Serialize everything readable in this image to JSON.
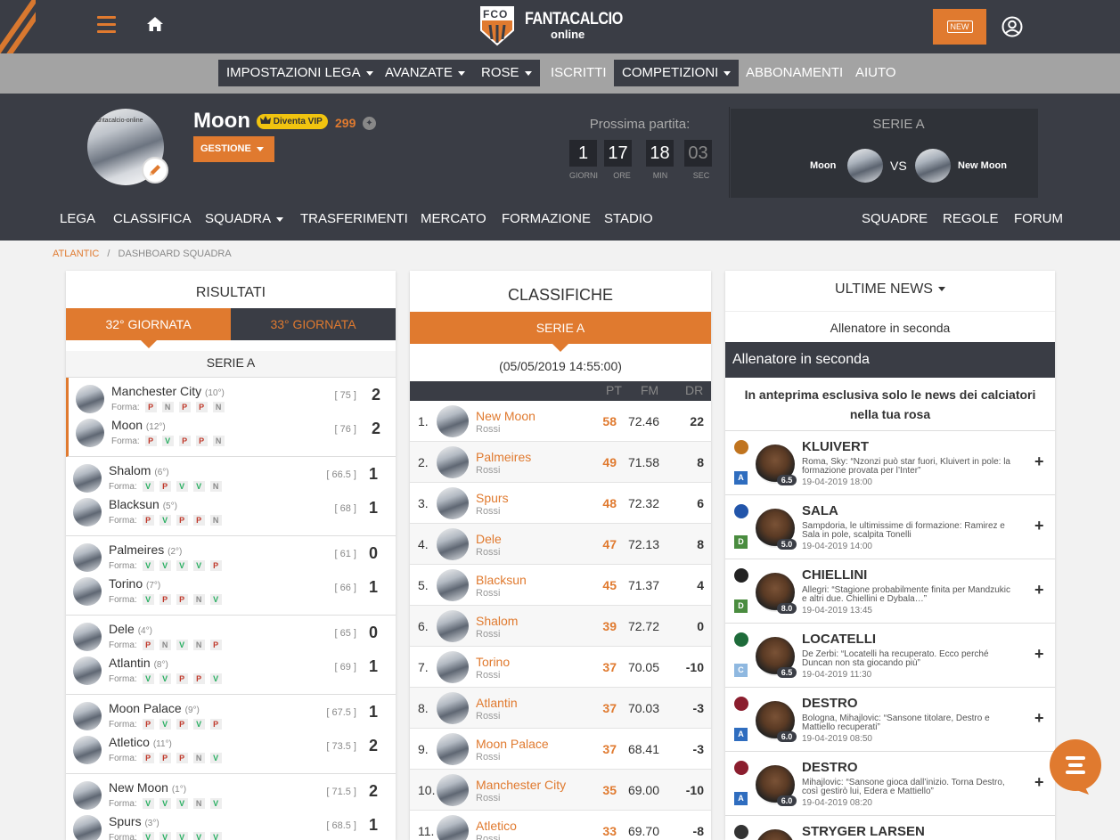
{
  "brand": {
    "logo_mark": "FCO",
    "logo_title": "FANTACALCIO",
    "logo_sub": "online",
    "new_label": "NEW"
  },
  "menu": [
    {
      "label": "IMPOSTAZIONI LEGA",
      "dropdown": true
    },
    {
      "label": "AVANZATE",
      "dropdown": true
    },
    {
      "label": "ROSE",
      "dropdown": true
    },
    {
      "label": "ISCRITTI",
      "dropdown": false
    },
    {
      "label": "COMPETIZIONI",
      "dropdown": true
    },
    {
      "label": "ABBONAMENTI",
      "dropdown": false
    },
    {
      "label": "AIUTO",
      "dropdown": false
    }
  ],
  "team": {
    "name": "Moon",
    "vip_label": "Diventa VIP",
    "credits": "299",
    "gestione_label": "GESTIONE",
    "avatar_text": "fantacalcio-online"
  },
  "next_match": {
    "label": "Prossima partita:",
    "countdown": [
      {
        "value": "1",
        "unit": "GIORNI"
      },
      {
        "value": "17",
        "unit": "ORE"
      },
      {
        "value": "18",
        "unit": "MIN"
      },
      {
        "value": "03",
        "unit": "SEC"
      }
    ],
    "competition": "SERIE A",
    "home": "Moon",
    "vs": "VS",
    "away": "New Moon"
  },
  "subnav": {
    "left": [
      "LEGA",
      "CLASSIFICA",
      "SQUADRA",
      "TRASFERIMENTI",
      "MERCATO",
      "FORMAZIONE",
      "STADIO"
    ],
    "right": [
      "SQUADRE",
      "REGOLE",
      "FORUM"
    ]
  },
  "breadcrumb": {
    "link": "ATLANTIC",
    "sep": "/",
    "current": "DASHBOARD SQUADRA"
  },
  "risultati": {
    "title": "RISULTATI",
    "tabs": [
      "32° GIORNATA",
      "33° GIORNATA"
    ],
    "league": "SERIE A",
    "forma_label": "Forma:",
    "matches": [
      {
        "teams": [
          {
            "name": "Manchester City",
            "pos": "(10°)",
            "forma": [
              "P",
              "N",
              "P",
              "P",
              "N"
            ],
            "pts": "[ 75 ]",
            "goals": "2"
          },
          {
            "name": "Moon",
            "pos": "(12°)",
            "forma": [
              "P",
              "V",
              "P",
              "P",
              "N"
            ],
            "pts": "[ 76 ]",
            "goals": "2"
          }
        ]
      },
      {
        "teams": [
          {
            "name": "Shalom",
            "pos": "(6°)",
            "forma": [
              "V",
              "P",
              "V",
              "V",
              "N"
            ],
            "pts": "[ 66.5 ]",
            "goals": "1"
          },
          {
            "name": "Blacksun",
            "pos": "(5°)",
            "forma": [
              "P",
              "V",
              "P",
              "P",
              "N"
            ],
            "pts": "[ 68 ]",
            "goals": "1"
          }
        ]
      },
      {
        "teams": [
          {
            "name": "Palmeires",
            "pos": "(2°)",
            "forma": [
              "V",
              "V",
              "V",
              "V",
              "P"
            ],
            "pts": "[ 61 ]",
            "goals": "0"
          },
          {
            "name": "Torino",
            "pos": "(7°)",
            "forma": [
              "V",
              "P",
              "P",
              "N",
              "V"
            ],
            "pts": "[ 66 ]",
            "goals": "1"
          }
        ]
      },
      {
        "teams": [
          {
            "name": "Dele",
            "pos": "(4°)",
            "forma": [
              "P",
              "N",
              "V",
              "N",
              "P"
            ],
            "pts": "[ 65 ]",
            "goals": "0"
          },
          {
            "name": "Atlantin",
            "pos": "(8°)",
            "forma": [
              "V",
              "V",
              "P",
              "P",
              "V"
            ],
            "pts": "[ 69 ]",
            "goals": "1"
          }
        ]
      },
      {
        "teams": [
          {
            "name": "Moon Palace",
            "pos": "(9°)",
            "forma": [
              "P",
              "V",
              "P",
              "V",
              "P"
            ],
            "pts": "[ 67.5 ]",
            "goals": "1"
          },
          {
            "name": "Atletico",
            "pos": "(11°)",
            "forma": [
              "P",
              "P",
              "P",
              "N",
              "V"
            ],
            "pts": "[ 73.5 ]",
            "goals": "2"
          }
        ]
      },
      {
        "teams": [
          {
            "name": "New Moon",
            "pos": "(1°)",
            "forma": [
              "V",
              "V",
              "V",
              "N",
              "V"
            ],
            "pts": "[ 71.5 ]",
            "goals": "2"
          },
          {
            "name": "Spurs",
            "pos": "(3°)",
            "forma": [
              "V",
              "V",
              "V",
              "V",
              "V"
            ],
            "pts": "[ 68.5 ]",
            "goals": "1"
          }
        ]
      }
    ]
  },
  "classifiche": {
    "title": "CLASSIFICHE",
    "tab": "SERIE A",
    "date": "(05/05/2019 14:55:00)",
    "columns": [
      "PT",
      "FM",
      "DR"
    ],
    "rows": [
      {
        "rank": "1.",
        "name": "New Moon",
        "owner": "Rossi",
        "pt": "58",
        "fm": "72.46",
        "dr": "22"
      },
      {
        "rank": "2.",
        "name": "Palmeires",
        "owner": "Rossi",
        "pt": "49",
        "fm": "71.58",
        "dr": "8"
      },
      {
        "rank": "3.",
        "name": "Spurs",
        "owner": "Rossi",
        "pt": "48",
        "fm": "72.32",
        "dr": "6"
      },
      {
        "rank": "4.",
        "name": "Dele",
        "owner": "Rossi",
        "pt": "47",
        "fm": "72.13",
        "dr": "8"
      },
      {
        "rank": "5.",
        "name": "Blacksun",
        "owner": "Rossi",
        "pt": "45",
        "fm": "71.37",
        "dr": "4"
      },
      {
        "rank": "6.",
        "name": "Shalom",
        "owner": "Rossi",
        "pt": "39",
        "fm": "72.72",
        "dr": "0"
      },
      {
        "rank": "7.",
        "name": "Torino",
        "owner": "Rossi",
        "pt": "37",
        "fm": "70.05",
        "dr": "-10"
      },
      {
        "rank": "8.",
        "name": "Atlantin",
        "owner": "Rossi",
        "pt": "37",
        "fm": "70.03",
        "dr": "-3"
      },
      {
        "rank": "9.",
        "name": "Moon Palace",
        "owner": "Rossi",
        "pt": "37",
        "fm": "68.41",
        "dr": "-3"
      },
      {
        "rank": "10.",
        "name": "Manchester City",
        "owner": "Rossi",
        "pt": "35",
        "fm": "69.00",
        "dr": "-10"
      },
      {
        "rank": "11.",
        "name": "Atletico",
        "owner": "Rossi",
        "pt": "33",
        "fm": "69.70",
        "dr": "-8"
      }
    ]
  },
  "news": {
    "title": "ULTIME NEWS",
    "filter": "Allenatore in seconda",
    "section": "Allenatore in seconda",
    "promo": "In anteprima esclusiva solo le news dei calciatori nella tua rosa",
    "items": [
      {
        "player": "KLUIVERT",
        "text": "Roma, Sky: “Nzonzi può star fuori, Kluivert in pole: la formazione provata per l’Inter”",
        "date": "19-04-2019 18:00",
        "role": "A",
        "vote": "6.5",
        "role_color": "#2f6dbf",
        "club_color": "#c0741f"
      },
      {
        "player": "SALA",
        "text": "Sampdoria, le ultimissime di formazione: Ramirez e Sala in pole, scalpita Tonelli",
        "date": "19-04-2019 14:00",
        "role": "D",
        "vote": "5.0",
        "role_color": "#4a8c3f",
        "club_color": "#2255aa"
      },
      {
        "player": "CHIELLINI",
        "text": "Allegri: “Stagione probabilmente finita per Mandzukic e altri due. Chiellini e Dybala…”",
        "date": "19-04-2019 13:45",
        "role": "D",
        "vote": "8.0",
        "role_color": "#4a8c3f",
        "club_color": "#222222"
      },
      {
        "player": "LOCATELLI",
        "text": "De Zerbi: “Locatelli ha recuperato. Ecco perché Duncan non sta giocando più”",
        "date": "19-04-2019 11:30",
        "role": "C",
        "vote": "6.5",
        "role_color": "#8fb8e0",
        "club_color": "#1e6b3a"
      },
      {
        "player": "DESTRO",
        "text": "Bologna, Mihajlovic: “Sansone titolare, Destro e Mattiello recuperati”",
        "date": "19-04-2019 08:50",
        "role": "A",
        "vote": "6.0",
        "role_color": "#2f6dbf",
        "club_color": "#8b1e2e"
      },
      {
        "player": "DESTRO",
        "text": "Mihajlovic: “Sansone gioca dall’inizio. Torna Destro, così gestirò lui, Edera e Mattiello”",
        "date": "19-04-2019 08:20",
        "role": "A",
        "vote": "6.0",
        "role_color": "#2f6dbf",
        "club_color": "#8b1e2e"
      },
      {
        "player": "STRYGER LARSEN",
        "text": "",
        "date": "",
        "role": "",
        "vote": "",
        "role_color": "#2f6dbf",
        "club_color": "#333333"
      }
    ]
  }
}
